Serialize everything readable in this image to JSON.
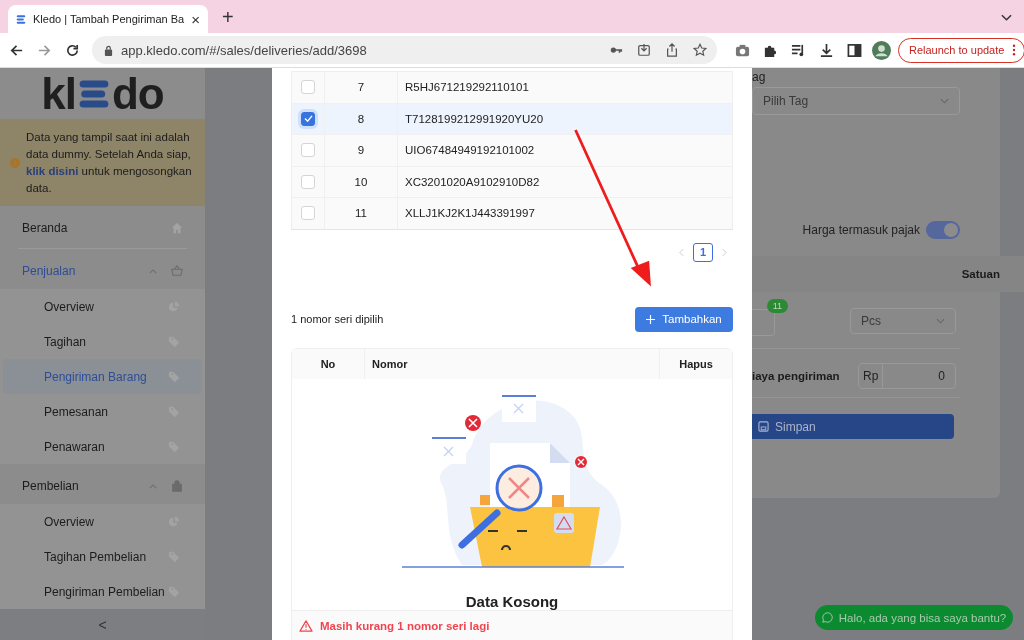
{
  "browser": {
    "tab": {
      "title": "Kledo | Tambah Pengiriman Ba",
      "close": "×"
    },
    "new_tab": "+",
    "url": "app.kledo.com/#/sales/deliveries/add/3698",
    "relaunch_button": "Relaunch to update"
  },
  "sidebar": {
    "logo": {
      "before": "kl",
      "after": "do"
    },
    "notice": {
      "before": "Data yang tampil saat ini adalah data dummy. Setelah Anda siap,",
      "link": "klik disini",
      "after": "untuk mengosongkan data."
    },
    "items": [
      {
        "label": "Beranda",
        "kind": "home",
        "selected": false
      },
      {
        "label": "Penjualan",
        "kind": "basket",
        "selected": true,
        "expanded": true,
        "children": [
          {
            "label": "Overview",
            "kind": "chart",
            "selected": false
          },
          {
            "label": "Tagihan",
            "kind": "tag",
            "selected": false
          },
          {
            "label": "Pengiriman Barang",
            "kind": "tag",
            "selected": true
          },
          {
            "label": "Pemesanan",
            "kind": "tag",
            "selected": false
          },
          {
            "label": "Penawaran",
            "kind": "tag",
            "selected": false
          }
        ]
      },
      {
        "label": "Pembelian",
        "kind": "bag",
        "selected": false,
        "expanded": true,
        "children": [
          {
            "label": "Overview",
            "kind": "chart",
            "selected": false
          },
          {
            "label": "Tagihan Pembelian",
            "kind": "tag",
            "selected": false
          },
          {
            "label": "Pengiriman Pembelian",
            "kind": "tag",
            "selected": false
          }
        ]
      }
    ],
    "collapse": "<"
  },
  "background": {
    "tag_label": "ag",
    "tag_placeholder": "Pilih Tag",
    "tax_toggle": {
      "label": "Harga termasuk pajak",
      "on": true
    },
    "unit_header": "Satuan",
    "qty_badge": "11",
    "unit_value": "Pcs",
    "shipping_label": "iaya pengiriman",
    "currency": "Rp",
    "shipping_value": "0",
    "save_button": "Simpan"
  },
  "modal": {
    "serials": [
      {
        "no": "7",
        "serial": "R5HJ671219292110101",
        "checked": false
      },
      {
        "no": "8",
        "serial": "T7128199212991920YU20",
        "checked": true
      },
      {
        "no": "9",
        "serial": "UIO67484949192101002",
        "checked": false
      },
      {
        "no": "10",
        "serial": "XC3201020A9102910D82",
        "checked": false
      },
      {
        "no": "11",
        "serial": "XLLJ1KJ2K1J443391997",
        "checked": false
      }
    ],
    "pages": [
      {
        "label": "1",
        "selected": true
      }
    ],
    "selected_count": "1 nomor seri dipilih",
    "add_button": "Tambahkan",
    "chosen": {
      "columns": [
        "No",
        "Nomor",
        "Hapus"
      ],
      "empty_title": "Data Kosong",
      "warning": "Masih kurang 1 nomor seri lagi"
    }
  },
  "chat_button": "Halo, ada yang bisa saya bantu?"
}
